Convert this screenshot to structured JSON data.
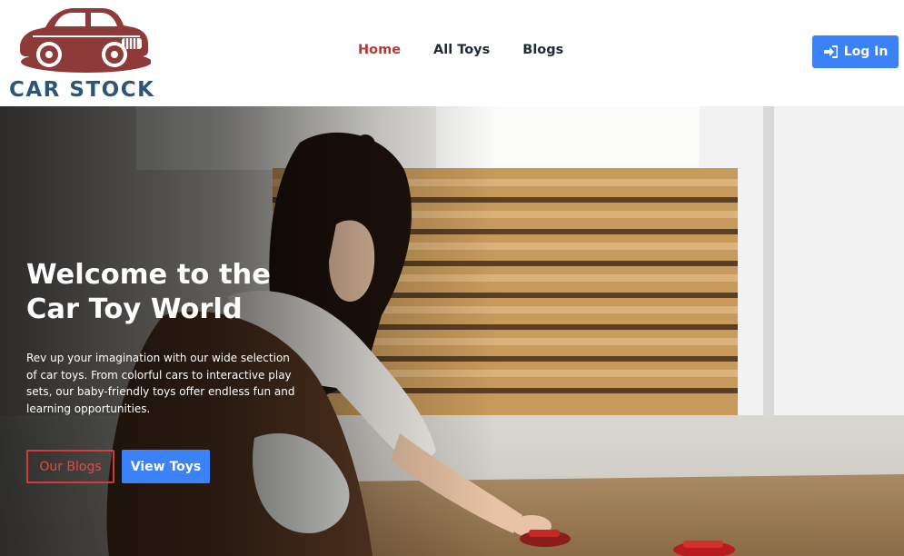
{
  "brand": {
    "name": "CAR STOCK",
    "logo_icon": "vintage-car-icon",
    "logo_color": "#8e3a38",
    "text_color": "#2d5577"
  },
  "nav": {
    "items": [
      {
        "label": "Home",
        "active": true
      },
      {
        "label": "All Toys",
        "active": false
      },
      {
        "label": "Blogs",
        "active": false
      }
    ],
    "active_color": "#b33a3a"
  },
  "auth": {
    "login_label": "Log In",
    "login_icon": "sign-in-icon",
    "color": "#3b82f6"
  },
  "hero": {
    "title": "Welcome to the Car Toy World",
    "description": "Rev up your imagination with our wide selection of car toys. From colorful cars to interactive play sets, our baby-friendly toys offer endless fun and learning opportunities.",
    "primary_button": "Our Blogs",
    "secondary_button": "View Toys",
    "outline_color": "#d43b3b",
    "image": "girl-playing-with-toy-cars-photo"
  }
}
